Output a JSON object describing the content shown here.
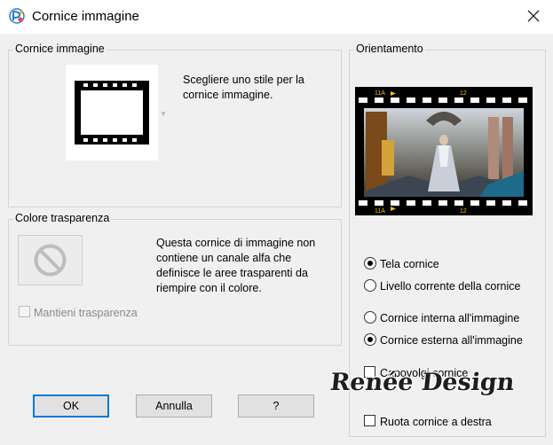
{
  "window": {
    "title": "Cornice immagine"
  },
  "frame_group": {
    "label": "Cornice immagine",
    "description": "Scegliere uno stile per la cornice immagine."
  },
  "transparency_group": {
    "label": "Colore trasparenza",
    "description": "Questa cornice di immagine non contiene un canale alfa che definisce le aree trasparenti da riempire con il colore.",
    "keep_transparency": {
      "label": "Mantieni trasparenza",
      "checked": false,
      "enabled": false
    }
  },
  "orientation_group": {
    "label": "Orientamento",
    "film_marks": {
      "top_left": "11A",
      "top_right": "12",
      "bottom_left": "11A",
      "bottom_right": "12"
    },
    "options": {
      "frame_canvas": {
        "label": "Tela cornice",
        "selected": true
      },
      "frame_current_layer": {
        "label": "Livello corrente della cornice",
        "selected": false
      },
      "frame_inside": {
        "label": "Cornice interna all'immagine",
        "selected": false
      },
      "frame_outside": {
        "label": "Cornice esterna all'immagine",
        "selected": true
      },
      "flip_frame": {
        "label": "Capovolgi cornice",
        "checked": false
      },
      "rotate_frame": {
        "label": "Ruota cornice a destra",
        "checked": false
      }
    }
  },
  "buttons": {
    "ok": "OK",
    "cancel": "Annulla",
    "help": "?"
  },
  "watermark": "Renée Design",
  "colors": {
    "default_button_border": "#0078d7",
    "window_bg": "#f0f0f0",
    "film_accent": "#f4c400"
  }
}
